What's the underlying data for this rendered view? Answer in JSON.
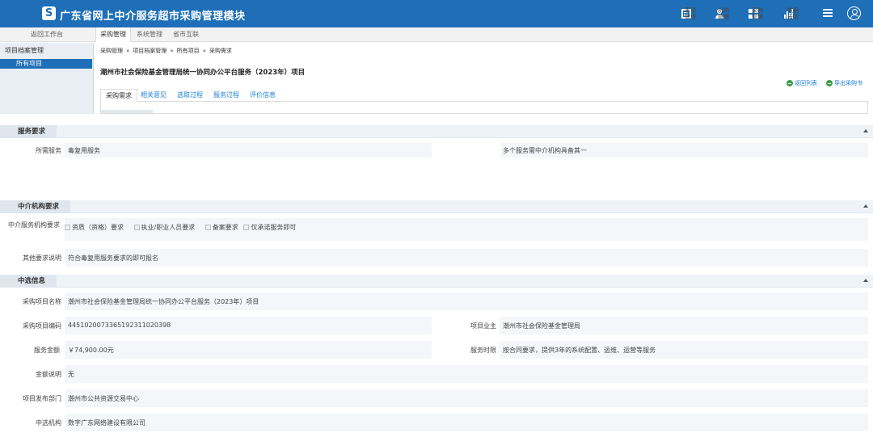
{
  "header": {
    "logo_glyph": "S",
    "title": "广东省网上中介服务超市采购管理模块",
    "buttons": [
      {
        "label": "事项管理",
        "icon": "document-icon"
      },
      {
        "label": "机构管理",
        "icon": "person-icon"
      },
      {
        "label": "采购管理",
        "icon": "grid-icon"
      },
      {
        "label": "数据云图",
        "icon": "chart-icon"
      }
    ]
  },
  "nav": {
    "back": "返回工作台",
    "tabs": [
      "采购管理",
      "系统管理",
      "省市互联"
    ]
  },
  "sidebar": {
    "group": "项目档案管理",
    "item": "所有项目"
  },
  "breadcrumb": [
    "采购管理",
    "项目档案管理",
    "所有项目",
    "采购需求"
  ],
  "breadcrumb_sep": "»",
  "project_title": "潮州市社会保险基金管理局统一协同办公平台服务（2023年）项目",
  "actions": {
    "back_list": "返回列表",
    "export": "导出采购书"
  },
  "tabs": [
    "采购需求",
    "相关意见",
    "选取过程",
    "服务过程",
    "评价信息"
  ],
  "service_req": {
    "title": "服务要求",
    "label": "所需服务",
    "value": "毒复用服务",
    "note": "多个服务需中介机构具备其一"
  },
  "agency_req": {
    "title": "中介机构要求",
    "label": "中介服务机构要求",
    "options": [
      "资质（资格）要求",
      "执业/职业人员要求",
      "备案要求",
      "仅承诺服务即可"
    ],
    "other_label": "其他要求说明",
    "other_value": "符合毒复用服务要求的即可报名"
  },
  "selected": {
    "title": "中选信息",
    "name_label": "采购项目名称",
    "name_value": "潮州市社会保险基金管理局统一协同办公平台服务（2023年）项目",
    "code_label": "采购项目编码",
    "code_value": "44510200733651923110​20398",
    "owner_label": "项目业主",
    "owner_value": "潮州市社会保险基金管理局",
    "amount_label": "服务金额",
    "amount_value": "￥74,900.00元",
    "period_label": "服务时限",
    "period_value": "按合同要求，提供3年的系统配置、运维、运营等服务",
    "amount_note_label": "金额说明",
    "amount_note_value": "无",
    "dept_label": "项目发布部门",
    "dept_value": "潮州市公共资源交易中心",
    "org_label": "中选机构",
    "org_value": "数字广东网络建设有限公司"
  }
}
